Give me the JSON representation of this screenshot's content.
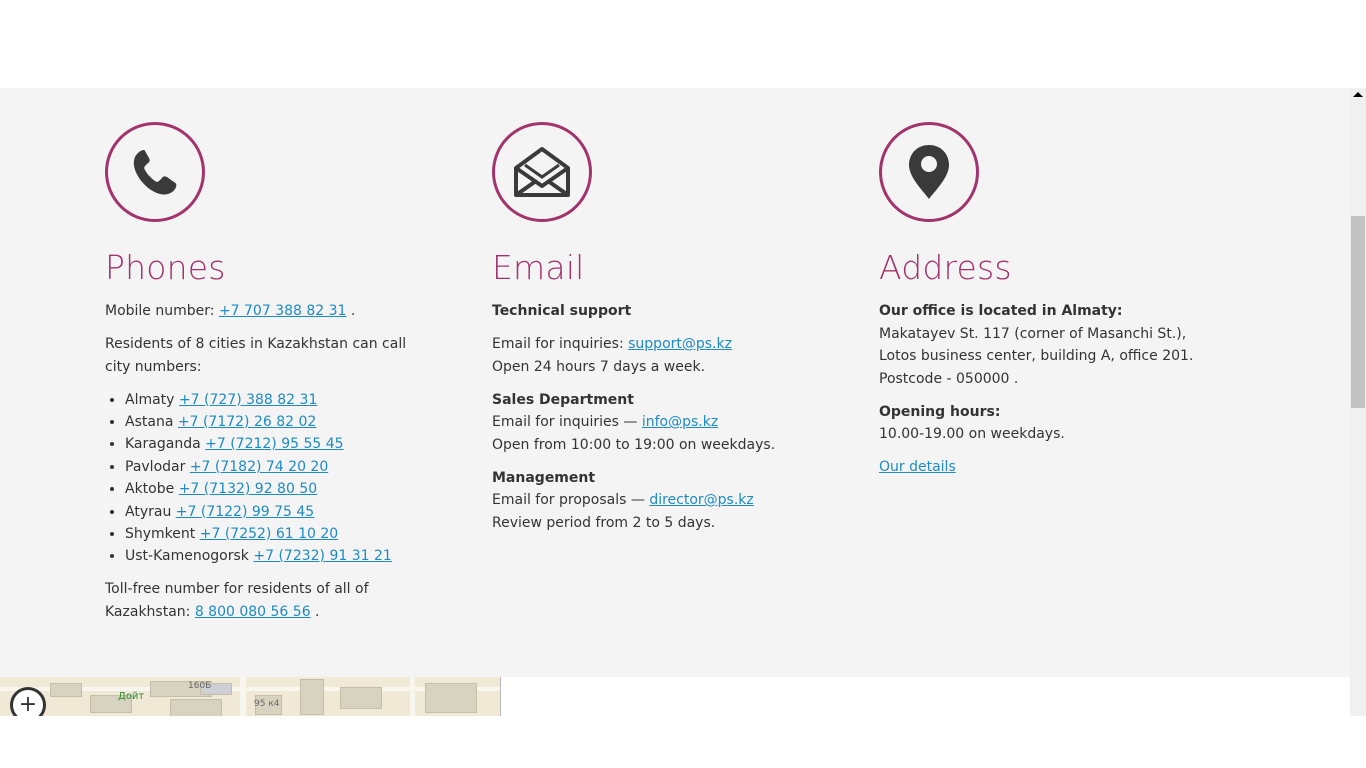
{
  "phones": {
    "title": "Phones",
    "icon": "phone-icon",
    "mobile_prefix": "Mobile number: ",
    "mobile_number": "+7 707 388 82 31",
    "mobile_suffix": " .",
    "cities_intro": "Residents of 8 cities in Kazakhstan can call city numbers:",
    "cities": [
      {
        "name": "Almaty",
        "number": "+7 (727) 388 82 31"
      },
      {
        "name": "Astana",
        "number": "+7 (7172) 26 82 02"
      },
      {
        "name": "Karaganda",
        "number": "+7 (7212) 95 55 45"
      },
      {
        "name": "Pavlodar",
        "number": "+7 (7182) 74 20 20"
      },
      {
        "name": "Aktobe",
        "number": "+7 (7132) 92 80 50"
      },
      {
        "name": "Atyrau",
        "number": "+7 (7122) 99 75 45"
      },
      {
        "name": "Shymkent",
        "number": "+7 (7252) 61 10 20"
      },
      {
        "name": "Ust-Kamenogorsk",
        "number": "+7 (7232) 91 31 21"
      }
    ],
    "tollfree_prefix": "Toll-free number for residents of all of Kazakhstan: ",
    "tollfree_number": "8 800 080 56 56",
    "tollfree_suffix": " ."
  },
  "email": {
    "title": "Email",
    "icon": "envelope-icon",
    "sections": [
      {
        "heading": "Technical support",
        "label": "Email for inquiries: ",
        "address": "support@ps.kz",
        "note": "Open 24 hours 7 days a week."
      },
      {
        "heading": "Sales Department",
        "label": "Email for inquiries — ",
        "address": "info@ps.kz",
        "note": "Open from 10:00 to 19:00 on weekdays."
      },
      {
        "heading": "Management",
        "label": "Email for proposals — ",
        "address": "director@ps.kz",
        "note": "Review period from 2 to 5 days."
      }
    ]
  },
  "address": {
    "title": "Address",
    "icon": "map-pin-icon",
    "office_heading": "Our office is located in Almaty:",
    "lines": [
      "Makatayev St. 117 (corner of Masanchi St.),",
      "Lotos business center, building A, office 201.",
      "Postcode - 050000 ."
    ],
    "hours_heading": "Opening hours:",
    "hours": "10.00-19.00 on weekdays.",
    "details_link": "Our details"
  },
  "map": {
    "poi_label": "Дойт",
    "labels": [
      "160Б",
      "95 к4"
    ],
    "zoom_in_symbol": "+"
  },
  "colors": {
    "accent": "#a3336d",
    "link": "#1e8bc3",
    "section_bg": "#f4f4f4",
    "text": "#333333"
  }
}
